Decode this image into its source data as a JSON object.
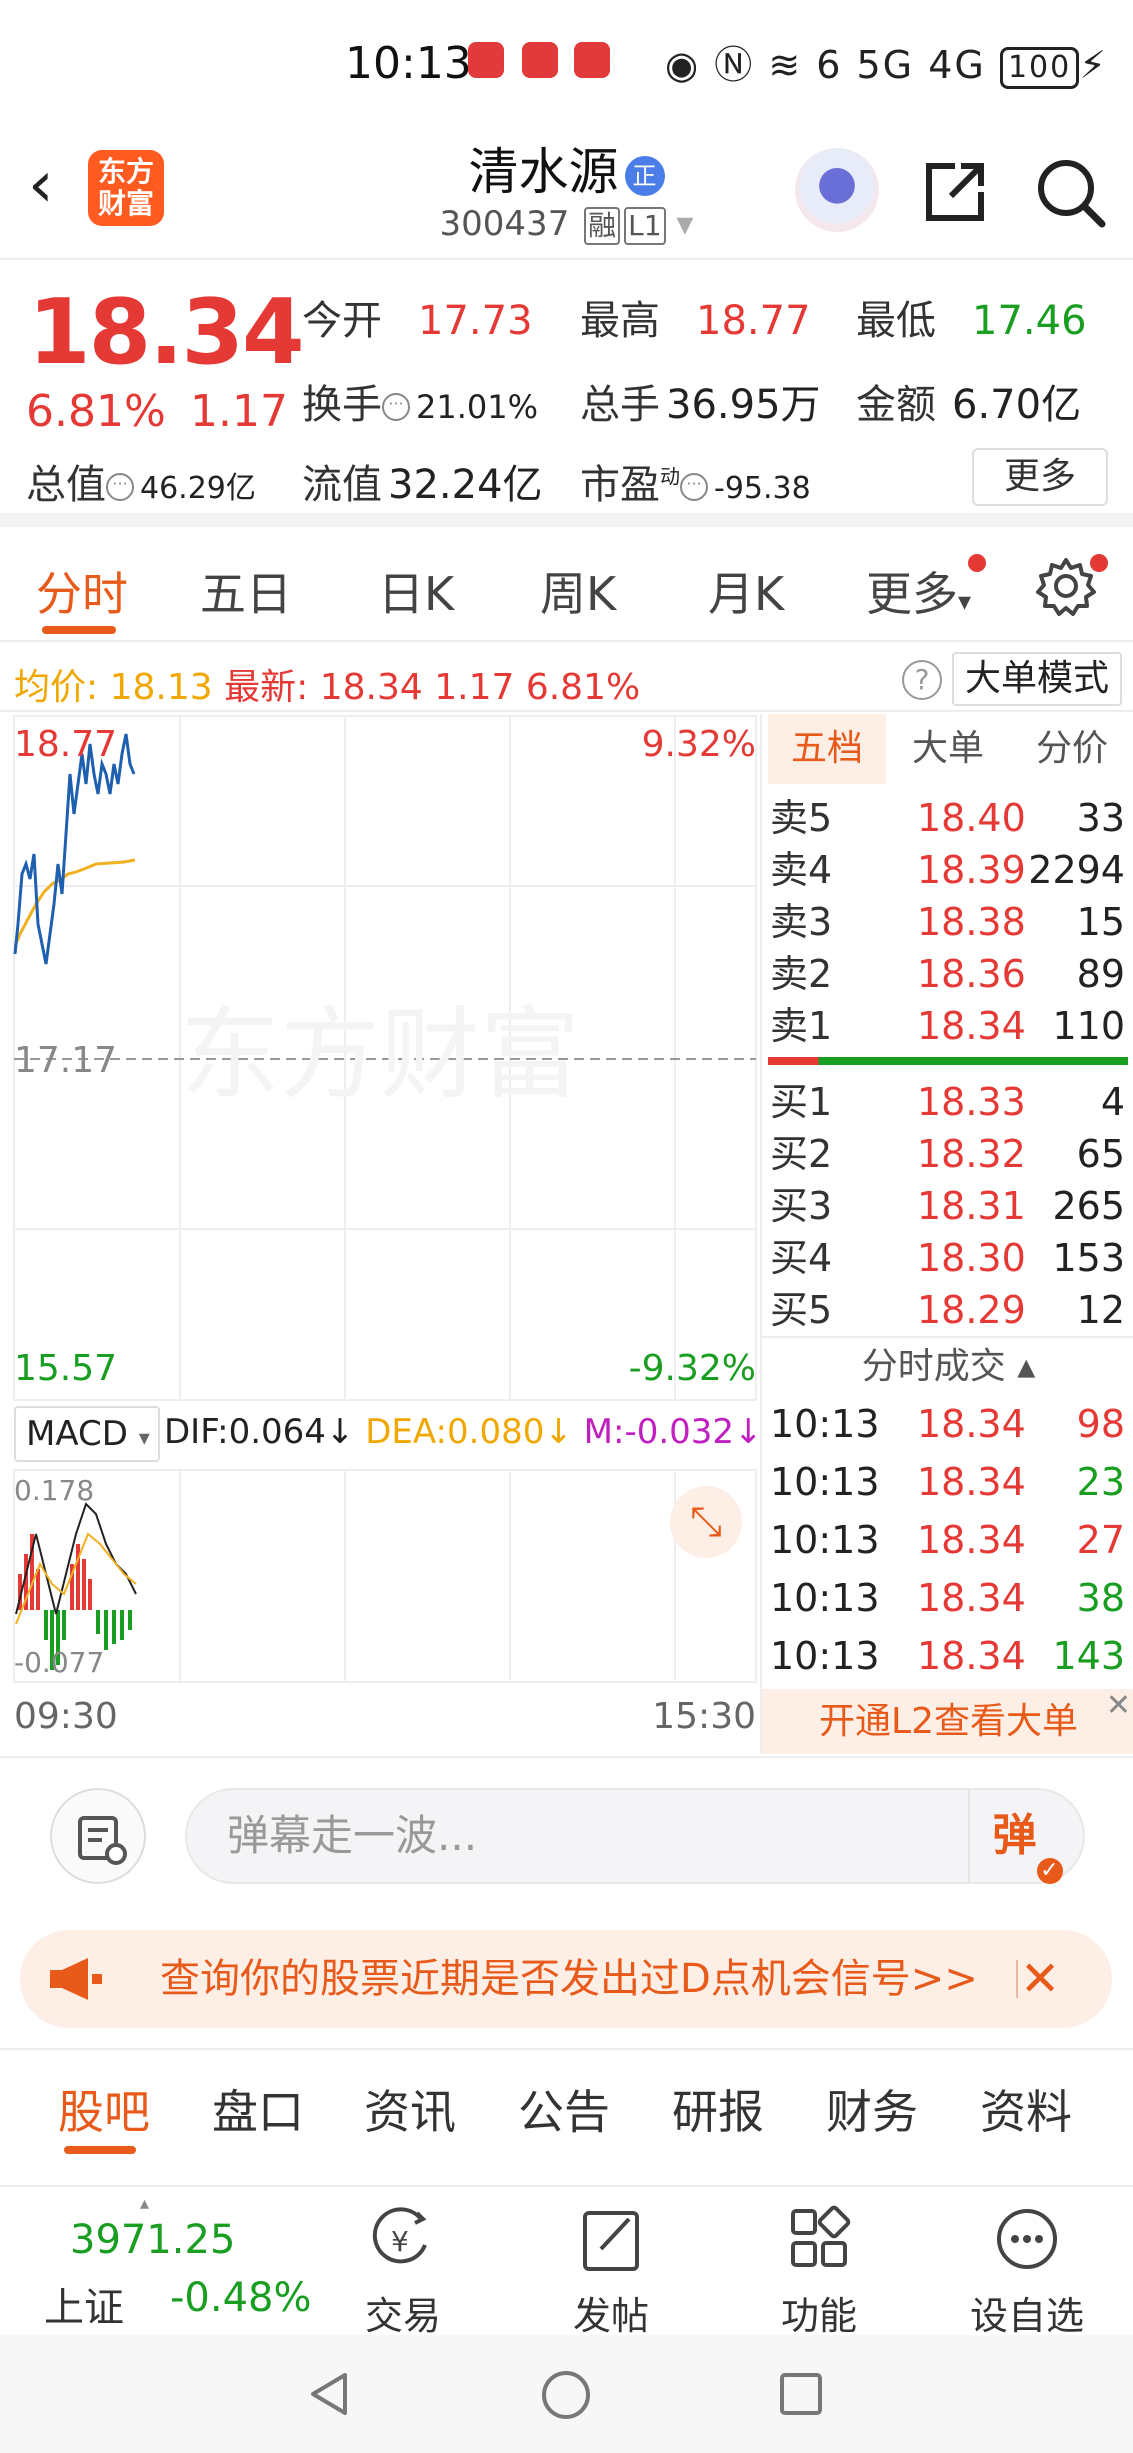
{
  "status_bar": {
    "time": "10:13",
    "signal_text": "6 5G 4G",
    "battery": "100"
  },
  "nav": {
    "back_icon": "chevron-left-icon",
    "logo_line1": "东方",
    "logo_line2": "财富",
    "stock_name": "清水源",
    "badge": "正",
    "stock_code": "300437",
    "tag_rong": "融",
    "tag_level": "L1"
  },
  "quote": {
    "price": "18.34",
    "pct": "6.81%",
    "change": "1.17",
    "open_label": "今开",
    "open": "17.73",
    "high_label": "最高",
    "high": "18.77",
    "low_label": "最低",
    "low": "17.46",
    "turnover_label": "换手",
    "turnover": "21.01%",
    "volume_label": "总手",
    "volume": "36.95万",
    "amount_label": "金额",
    "amount": "6.70亿",
    "mktcap_label": "总值",
    "mktcap": "46.29亿",
    "float_label": "流值",
    "float": "32.24亿",
    "pe_label": "市盈",
    "pe_sup": "动",
    "pe": "-95.38",
    "more_button": "更多"
  },
  "chart_tabs": [
    "分时",
    "五日",
    "日K",
    "周K",
    "月K",
    "更多"
  ],
  "avg_line": {
    "avg_label": "均价:",
    "avg": "18.13",
    "latest_label": "最新:",
    "latest": "18.34",
    "change": "1.17",
    "pct": "6.81%",
    "mode_button": "大单模式"
  },
  "chart": {
    "top_price": "18.77",
    "top_pct": "9.32%",
    "mid_price": "17.17",
    "bottom_price": "15.57",
    "bottom_pct": "-9.32%",
    "watermark": "东方财富",
    "time_start": "09:30",
    "time_end": "15:30",
    "macd": {
      "label": "MACD",
      "dif": "DIF:0.064",
      "dea": "DEA:0.080",
      "m": "M:-0.032",
      "top": "0.178",
      "bottom": "-0.077"
    }
  },
  "order_book": {
    "tabs": [
      "五档",
      "大单",
      "分价"
    ],
    "asks": [
      {
        "label": "卖5",
        "price": "18.40",
        "qty": "33"
      },
      {
        "label": "卖4",
        "price": "18.39",
        "qty": "2294"
      },
      {
        "label": "卖3",
        "price": "18.38",
        "qty": "15"
      },
      {
        "label": "卖2",
        "price": "18.36",
        "qty": "89"
      },
      {
        "label": "卖1",
        "price": "18.34",
        "qty": "110"
      }
    ],
    "bids": [
      {
        "label": "买1",
        "price": "18.33",
        "qty": "4"
      },
      {
        "label": "买2",
        "price": "18.32",
        "qty": "65"
      },
      {
        "label": "买3",
        "price": "18.31",
        "qty": "265"
      },
      {
        "label": "买4",
        "price": "18.30",
        "qty": "153"
      },
      {
        "label": "买5",
        "price": "18.29",
        "qty": "12"
      }
    ],
    "ticks_title": "分时成交",
    "ticks": [
      {
        "time": "10:13",
        "price": "18.34",
        "qty": "98",
        "dir": "up"
      },
      {
        "time": "10:13",
        "price": "18.34",
        "qty": "23",
        "dir": "down"
      },
      {
        "time": "10:13",
        "price": "18.34",
        "qty": "27",
        "dir": "up"
      },
      {
        "time": "10:13",
        "price": "18.34",
        "qty": "38",
        "dir": "down"
      },
      {
        "time": "10:13",
        "price": "18.34",
        "qty": "143",
        "dir": "down"
      }
    ],
    "l2_promo": "开通L2查看大单"
  },
  "danmu": {
    "placeholder": "弹幕走一波...",
    "send": "弹"
  },
  "banner": {
    "text": "查询你的股票近期是否发出过D点机会信号>>"
  },
  "sub_tabs": [
    "股吧",
    "盘口",
    "资讯",
    "公告",
    "研报",
    "财务",
    "资料"
  ],
  "bottom_nav": {
    "index_value": "3971.25",
    "index_name": "上证",
    "index_pct": "-0.48%",
    "items": [
      "交易",
      "发帖",
      "功能",
      "设自选"
    ]
  },
  "colors": {
    "up": "#e53935",
    "down": "#1a9e22",
    "accent": "#e85a1a",
    "avg_line": "#f0a800",
    "price_line": "#1e5fb0"
  }
}
